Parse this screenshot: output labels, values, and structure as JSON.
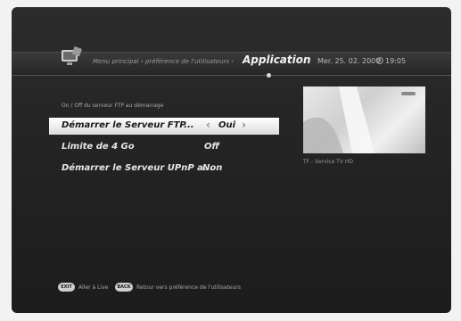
{
  "header": {
    "breadcrumb": "Menu principal › préférence de l'utilisateurs ›",
    "title": "Application",
    "date": "Mer. 25. 02. 2009",
    "time": "19:05"
  },
  "hint": "On / Off du serveur FTP au démarrage",
  "menu": [
    {
      "label": "Démarrer le Serveur FTP...",
      "value": "Oui",
      "selected": true
    },
    {
      "label": "Limite de 4 Go",
      "value": "Off",
      "selected": false
    },
    {
      "label": "Démarrer le Serveur UPnP a...",
      "value": "Non",
      "selected": false
    }
  ],
  "preview": {
    "channel": "TF - Service TV HD"
  },
  "footer": {
    "exit_key": "EXIT",
    "exit_label": "Aller à Live",
    "back_key": "BACK",
    "back_label": "Retour vers préférence de l'utilisateurs"
  },
  "icons": {
    "header": "tv-settings-icon",
    "clock": "clock-icon",
    "left": "chevron-left-icon",
    "right": "chevron-right-icon"
  }
}
